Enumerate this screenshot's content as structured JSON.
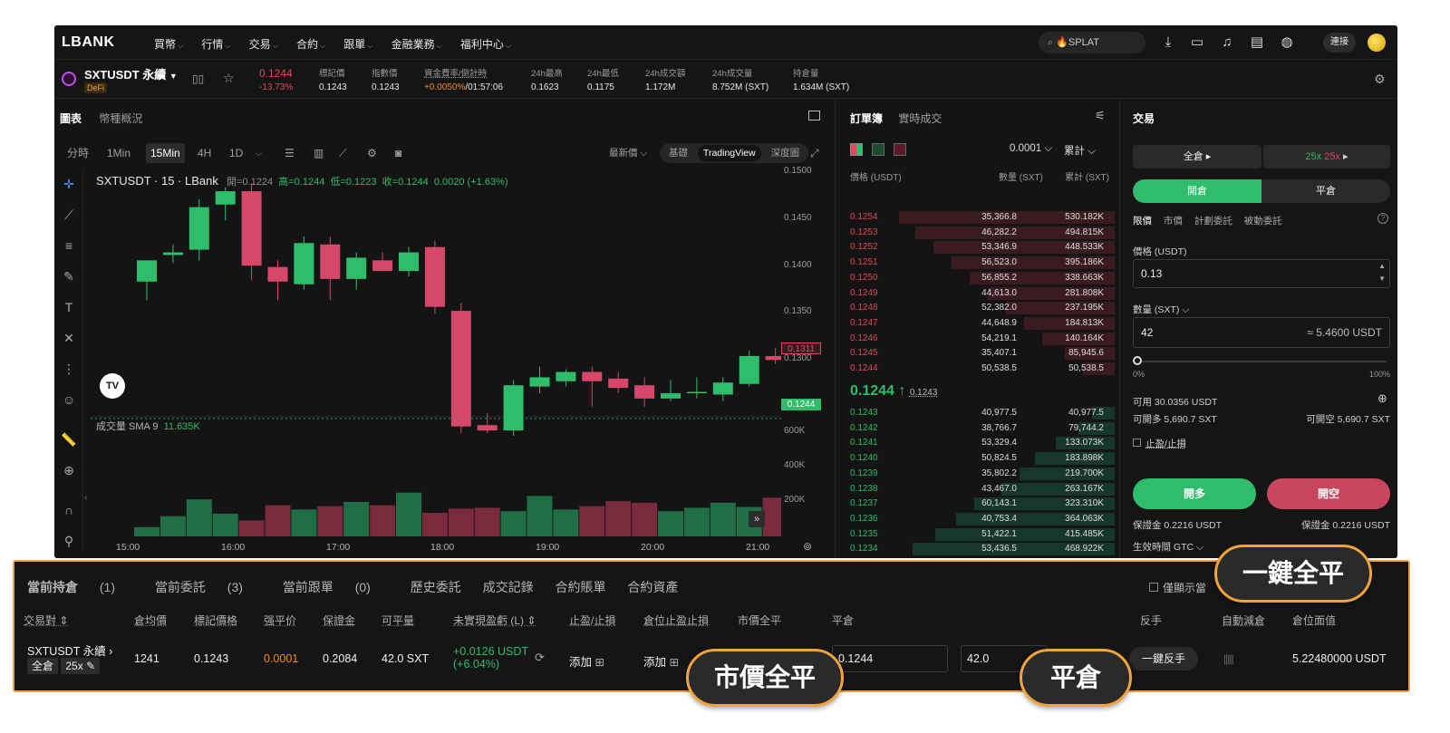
{
  "nav": {
    "logo": "LBANK",
    "menu": [
      "買幣",
      "行情",
      "交易",
      "合約",
      "跟單",
      "金融業務",
      "福利中心"
    ],
    "search_value": "SPLAT",
    "login_label": "連接"
  },
  "ticker": {
    "symbol": "SXTUSDT 永續",
    "tag": "DeFi",
    "price": "0.1244",
    "change": "-13.73%",
    "stats": [
      {
        "label": "標記價",
        "value": "0.1243"
      },
      {
        "label": "指數價",
        "value": "0.1243"
      },
      {
        "label": "資金費率/倒計時",
        "value": "+0.0050%/01:57:06"
      },
      {
        "label": "24h最高",
        "value": "0.1623"
      },
      {
        "label": "24h最低",
        "value": "0.1175"
      },
      {
        "label": "24h成交額",
        "value": "1.172M"
      },
      {
        "label": "24h成交量",
        "value": "8.752M (SXT)"
      },
      {
        "label": "持倉量",
        "value": "1.634M (SXT)"
      }
    ]
  },
  "chart": {
    "tabs": [
      "圖表",
      "幣種概況"
    ],
    "timeframes": [
      "分時",
      "1Min",
      "15Min",
      "4H",
      "1D"
    ],
    "active_tf": "15Min",
    "price_source": "最新價",
    "views": [
      "基礎",
      "TradingView",
      "深度圖"
    ],
    "legend_title": "SXTUSDT · 15 · LBank",
    "legend_open": "開=0.1224",
    "legend_high": "高=0.1244",
    "legend_low": "低=0.1223",
    "legend_close": "收=0.1244",
    "legend_change": "0.0020 (+1.63%)",
    "vol_label": "成交量 SMA 9",
    "vol_value": "11.635K",
    "tv_logo": "TV",
    "price_tag_current": "0.1244",
    "price_tag_mark": "0.1311",
    "y_ticks": [
      "0.1500",
      "0.1450",
      "0.1400",
      "0.1350",
      "0.1300"
    ],
    "vol_ticks": [
      "600K",
      "400K",
      "200K"
    ],
    "x_ticks": [
      "15:00",
      "16:00",
      "17:00",
      "18:00",
      "19:00",
      "20:00",
      "21:00"
    ]
  },
  "chart_data": {
    "type": "candlestick",
    "title": "SXTUSDT · 15 · LBank",
    "ylim": [
      0.128,
      0.1505
    ],
    "candles": [
      {
        "o": 0.1424,
        "h": 0.1436,
        "l": 0.141,
        "c": 0.144
      },
      {
        "o": 0.1444,
        "h": 0.1452,
        "l": 0.1438,
        "c": 0.1446
      },
      {
        "o": 0.1448,
        "h": 0.1486,
        "l": 0.144,
        "c": 0.148
      },
      {
        "o": 0.1482,
        "h": 0.1495,
        "l": 0.147,
        "c": 0.1492
      },
      {
        "o": 0.1492,
        "h": 0.1498,
        "l": 0.1425,
        "c": 0.1436
      },
      {
        "o": 0.1435,
        "h": 0.144,
        "l": 0.141,
        "c": 0.1424
      },
      {
        "o": 0.1422,
        "h": 0.1458,
        "l": 0.1418,
        "c": 0.1453
      },
      {
        "o": 0.1452,
        "h": 0.1458,
        "l": 0.141,
        "c": 0.1426
      },
      {
        "o": 0.1426,
        "h": 0.1446,
        "l": 0.1418,
        "c": 0.1442
      },
      {
        "o": 0.144,
        "h": 0.1446,
        "l": 0.1432,
        "c": 0.1432
      },
      {
        "o": 0.1432,
        "h": 0.145,
        "l": 0.1428,
        "c": 0.1446
      },
      {
        "o": 0.145,
        "h": 0.1455,
        "l": 0.14,
        "c": 0.1405
      },
      {
        "o": 0.1402,
        "h": 0.1408,
        "l": 0.131,
        "c": 0.1315
      },
      {
        "o": 0.1316,
        "h": 0.1325,
        "l": 0.131,
        "c": 0.1312
      },
      {
        "o": 0.1312,
        "h": 0.135,
        "l": 0.1308,
        "c": 0.1346
      },
      {
        "o": 0.1345,
        "h": 0.136,
        "l": 0.134,
        "c": 0.1352
      },
      {
        "o": 0.1349,
        "h": 0.1358,
        "l": 0.1345,
        "c": 0.1356
      },
      {
        "o": 0.1356,
        "h": 0.136,
        "l": 0.133,
        "c": 0.1349
      },
      {
        "o": 0.1351,
        "h": 0.1356,
        "l": 0.134,
        "c": 0.1344
      },
      {
        "o": 0.1346,
        "h": 0.1352,
        "l": 0.133,
        "c": 0.1336
      },
      {
        "o": 0.1336,
        "h": 0.135,
        "l": 0.1334,
        "c": 0.134
      },
      {
        "o": 0.134,
        "h": 0.1352,
        "l": 0.1336,
        "c": 0.1341
      },
      {
        "o": 0.1339,
        "h": 0.1352,
        "l": 0.1334,
        "c": 0.1348
      },
      {
        "o": 0.1347,
        "h": 0.1372,
        "l": 0.1345,
        "c": 0.1368
      },
      {
        "o": 0.1368,
        "h": 0.1374,
        "l": 0.1362,
        "c": 0.1365
      },
      {
        "o": 0.1366,
        "h": 0.1374,
        "l": 0.1314,
        "c": 0.1336
      },
      {
        "o": 0.1332,
        "h": 0.1336,
        "l": 0.1306,
        "c": 0.1318
      }
    ],
    "volume": [
      55,
      120,
      220,
      135,
      95,
      185,
      160,
      180,
      205,
      185,
      260,
      140,
      165,
      170,
      150,
      240,
      160,
      180,
      210,
      200,
      150,
      170,
      200,
      175,
      230,
      320,
      240
    ],
    "volume_ylim": [
      0,
      700
    ]
  },
  "orderbook": {
    "tabs": [
      "訂單簿",
      "實時成交"
    ],
    "precision": "0.0001",
    "mode": "累計",
    "header": {
      "price": "價格 (USDT)",
      "qty": "數量 (SXT)",
      "cum": "累計 (SXT)"
    },
    "asks": [
      {
        "p": "0.1254",
        "q": "35,366.8",
        "c": "530.182K",
        "depth": 0.95
      },
      {
        "p": "0.1253",
        "q": "46,282.2",
        "c": "494.815K",
        "depth": 0.88
      },
      {
        "p": "0.1252",
        "q": "53,346.9",
        "c": "448.533K",
        "depth": 0.8
      },
      {
        "p": "0.1251",
        "q": "56,523.0",
        "c": "395.186K",
        "depth": 0.72
      },
      {
        "p": "0.1250",
        "q": "56,855.2",
        "c": "338.663K",
        "depth": 0.64
      },
      {
        "p": "0.1249",
        "q": "44,613.0",
        "c": "281.808K",
        "depth": 0.56
      },
      {
        "p": "0.1248",
        "q": "52,382.0",
        "c": "237.195K",
        "depth": 0.48
      },
      {
        "p": "0.1247",
        "q": "44,648.9",
        "c": "184.813K",
        "depth": 0.4
      },
      {
        "p": "0.1246",
        "q": "54,219.1",
        "c": "140.164K",
        "depth": 0.32
      },
      {
        "p": "0.1245",
        "q": "35,407.1",
        "c": "85,945.6",
        "depth": 0.22
      },
      {
        "p": "0.1244",
        "q": "50,538.5",
        "c": "50,538.5",
        "depth": 0.14
      }
    ],
    "last_price": "0.1244 ↑",
    "mark_price": "0.1243",
    "bids": [
      {
        "p": "0.1243",
        "q": "40,977.5",
        "c": "40,977.5",
        "depth": 0.1
      },
      {
        "p": "0.1242",
        "q": "38,766.7",
        "c": "79,744.2",
        "depth": 0.16
      },
      {
        "p": "0.1241",
        "q": "53,329.4",
        "c": "133.073K",
        "depth": 0.26
      },
      {
        "p": "0.1240",
        "q": "50,824.5",
        "c": "183.898K",
        "depth": 0.35
      },
      {
        "p": "0.1239",
        "q": "35,802.2",
        "c": "219.700K",
        "depth": 0.42
      },
      {
        "p": "0.1238",
        "q": "43,467.0",
        "c": "263.167K",
        "depth": 0.5
      },
      {
        "p": "0.1237",
        "q": "60,143.1",
        "c": "323.310K",
        "depth": 0.62
      },
      {
        "p": "0.1236",
        "q": "40,753.4",
        "c": "364.063K",
        "depth": 0.7
      },
      {
        "p": "0.1235",
        "q": "51,422.1",
        "c": "415.485K",
        "depth": 0.79
      },
      {
        "p": "0.1234",
        "q": "53,436.5",
        "c": "468.922K",
        "depth": 0.89
      },
      {
        "p": "0.1233",
        "q": "55,424.5",
        "c": "524.346K",
        "depth": 0.99
      }
    ]
  },
  "trade": {
    "title": "交易",
    "margin_mode": "全倉",
    "leverage": "25x",
    "leverage2": "25x",
    "open_tab": "開倉",
    "close_tab": "平倉",
    "order_types": [
      "限價",
      "市價",
      "計劃委託",
      "被動委託"
    ],
    "price_label": "價格 (USDT)",
    "price_value": "0.13",
    "qty_label": "數量 (SXT)",
    "qty_value": "42",
    "qty_est": "≈ 5.4600 USDT",
    "slider_min": "0%",
    "slider_max": "100%",
    "available": "可用 30.0356 USDT",
    "can_long": "可開多 5,690.7 SXT",
    "can_short": "可開空 5,690.7 SXT",
    "tpsl": "止盈/止損",
    "long_btn": "開多",
    "short_btn": "開空",
    "margin_long": "保證金 0.2216 USDT",
    "margin_short": "保證金 0.2216 USDT",
    "tif": "生效時間 GTC"
  },
  "positions": {
    "tabs": [
      "當前持倉",
      "當前委託",
      "當前跟單",
      "歷史委託",
      "成交記錄",
      "合約賬單",
      "合約資產"
    ],
    "tab_counts": [
      "(1)",
      "(3)",
      "(0)",
      "",
      "",
      "",
      ""
    ],
    "only_current": "僅顯示當",
    "headers": [
      "交易對",
      "倉均價",
      "標記價格",
      "强平价",
      "保證金",
      "可平量",
      "未實現盈虧 (L)",
      "止盈/止損",
      "倉位止盈止損",
      "市價全平",
      "平倉",
      "反手",
      "自動減倉",
      "倉位面值"
    ],
    "row": {
      "pair": "SXTUSDT 永續",
      "mode": "全倉",
      "lev": "25x",
      "avg": "1241",
      "mark": "0.1243",
      "liq": "0.0001",
      "margin": "0.2084",
      "closable": "42.0 SXT",
      "pnl": "+0.0126 USDT",
      "pnl_pct": "(+6.04%)",
      "add1": "添加",
      "add2": "添加",
      "close_price": "0.1244",
      "close_qty": "42.0",
      "reverse": "一鍵反手",
      "value": "5.22480000 USDT"
    }
  },
  "callouts": {
    "close_all": "一鍵全平",
    "market_close": "市價全平",
    "close": "平倉"
  },
  "colors": {
    "green": "#2fbd6c",
    "red": "#e0485f",
    "accent": "#f0a23c"
  }
}
